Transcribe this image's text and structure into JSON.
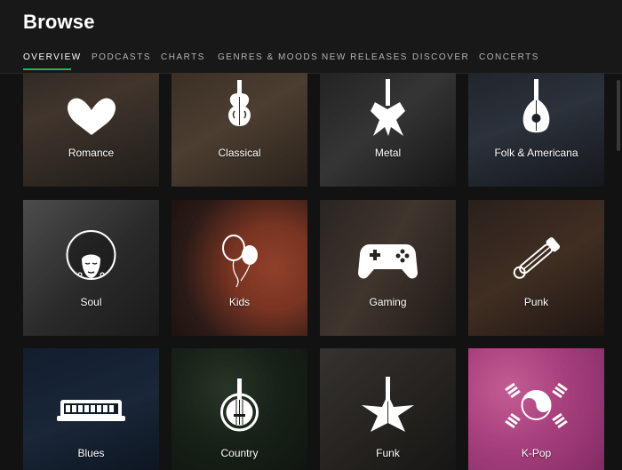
{
  "header": {
    "title": "Browse",
    "tabs": [
      {
        "label": "OVERVIEW",
        "active": true
      },
      {
        "label": "PODCASTS"
      },
      {
        "label": "CHARTS"
      },
      {
        "label": "GENRES & MOODS"
      },
      {
        "label": "NEW RELEASES"
      },
      {
        "label": "DISCOVER"
      },
      {
        "label": "CONCERTS"
      }
    ],
    "accent": "#1db954"
  },
  "tiles": [
    {
      "label": "Romance",
      "icon": "heart-icon"
    },
    {
      "label": "Classical",
      "icon": "violin-icon"
    },
    {
      "label": "Metal",
      "icon": "electric-guitar-icon"
    },
    {
      "label": "Folk & Americana",
      "icon": "mandolin-icon"
    },
    {
      "label": "Soul",
      "icon": "afro-face-icon"
    },
    {
      "label": "Kids",
      "icon": "balloons-icon"
    },
    {
      "label": "Gaming",
      "icon": "gamepad-icon"
    },
    {
      "label": "Punk",
      "icon": "safety-pin-icon"
    },
    {
      "label": "Blues",
      "icon": "harmonica-icon"
    },
    {
      "label": "Country",
      "icon": "banjo-icon"
    },
    {
      "label": "Funk",
      "icon": "star-guitar-icon"
    },
    {
      "label": "K-Pop",
      "icon": "taegeuk-icon"
    }
  ]
}
